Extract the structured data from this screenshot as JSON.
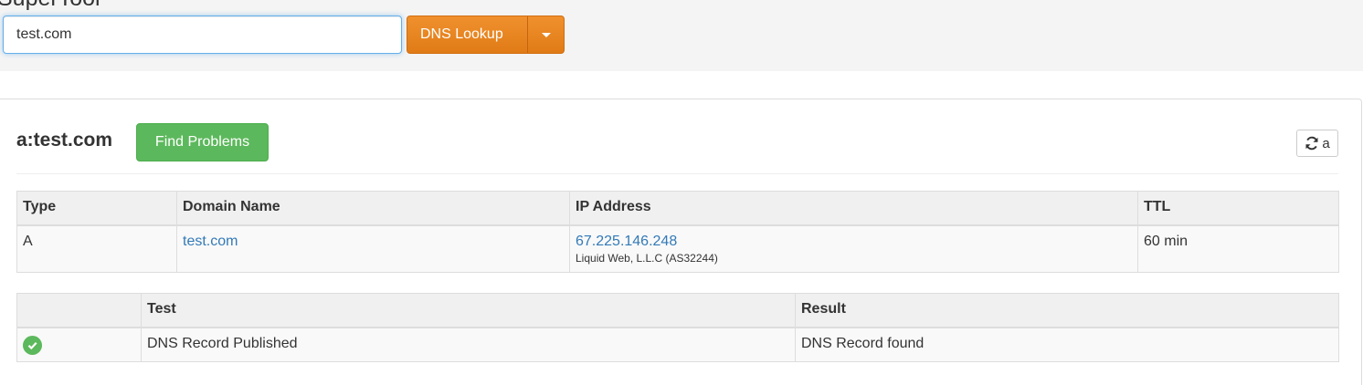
{
  "header": {
    "title": "SuperTool"
  },
  "search": {
    "value": "test.com",
    "button_label": "DNS Lookup"
  },
  "result": {
    "title": "a:test.com",
    "find_problems_label": "Find Problems",
    "refresh_label": "a"
  },
  "records_table": {
    "columns": [
      "Type",
      "Domain Name",
      "IP Address",
      "TTL"
    ],
    "rows": [
      {
        "type": "A",
        "domain": "test.com",
        "ip": "67.225.146.248",
        "ip_owner": "Liquid Web, L.L.C (AS32244)",
        "ttl": "60 min"
      }
    ]
  },
  "tests_table": {
    "columns": [
      "",
      "Test",
      "Result"
    ],
    "rows": [
      {
        "status_icon": "check-circle-icon",
        "test": "DNS Record Published",
        "result": "DNS Record found"
      }
    ]
  },
  "colors": {
    "accent_orange": "#e8861f",
    "success_green": "#5cb85c",
    "link_blue": "#337ab7"
  }
}
